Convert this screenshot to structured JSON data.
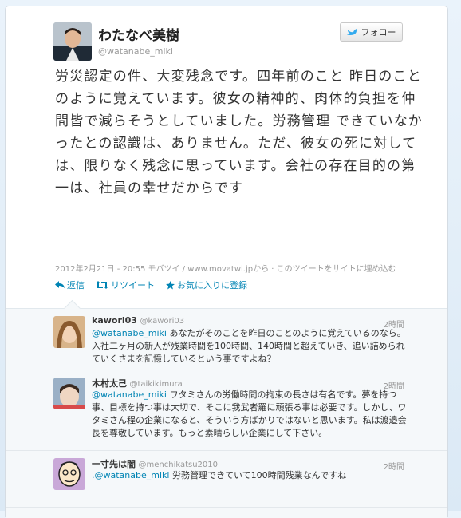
{
  "tweet": {
    "author_name": "わたなべ美樹",
    "author_handle": "@watanabe_miki",
    "follow_label": "フォロー",
    "text": "労災認定の件、大変残念です。四年前のこと 昨日のことのように覚えています。彼女の精神的、肉体的負担を仲間皆で減らそうとしていました。労務管理 できていなかったとの認識は、ありません。ただ、彼女の死に対しては、限りなく残念に思っています。会社の存在目的の第一は、社員の幸せだからです",
    "meta": "2012年2月21日 - 20:55 モバツイ / www.movatwi.jpから · このツイートをサイトに埋め込む",
    "actions": {
      "reply": "返信",
      "retweet": "リツイート",
      "favorite": "お気に入りに登録"
    }
  },
  "replies": [
    {
      "name": "kawori03",
      "handle": "@kawori03",
      "time": "2時間",
      "mention": "@watanabe_miki",
      "text": " あなたがそのことを昨日のことのように覚えているのなら。入社二ヶ月の新人が残業時間を100時間、140時間と超えていき、追い詰められていくさまを記憶しているという事ですよね？"
    },
    {
      "name": "木村太己",
      "handle": "@taikikimura",
      "time": "2時間",
      "mention": "@watanabe_miki",
      "text": " ワタミさんの労働時間の拘束の長さは有名です。夢を持つ事、目標を持つ事は大切で、そこに我武者羅に頑張る事は必要です。しかし、ワタミさん程の企業になると、そういう方ばかりではないと思います。私は渡邉会長を尊敬しています。もっと素晴らしい企業にして下さい。"
    },
    {
      "name": "一寸先は闇",
      "handle": "@menchikatsu2010",
      "time": "2時間",
      "mention": ".@watanabe_miki",
      "text": " 労務管理できていて100時間残業なんですね"
    }
  ],
  "colors": {
    "link": "#0084b4",
    "muted": "#999999"
  }
}
